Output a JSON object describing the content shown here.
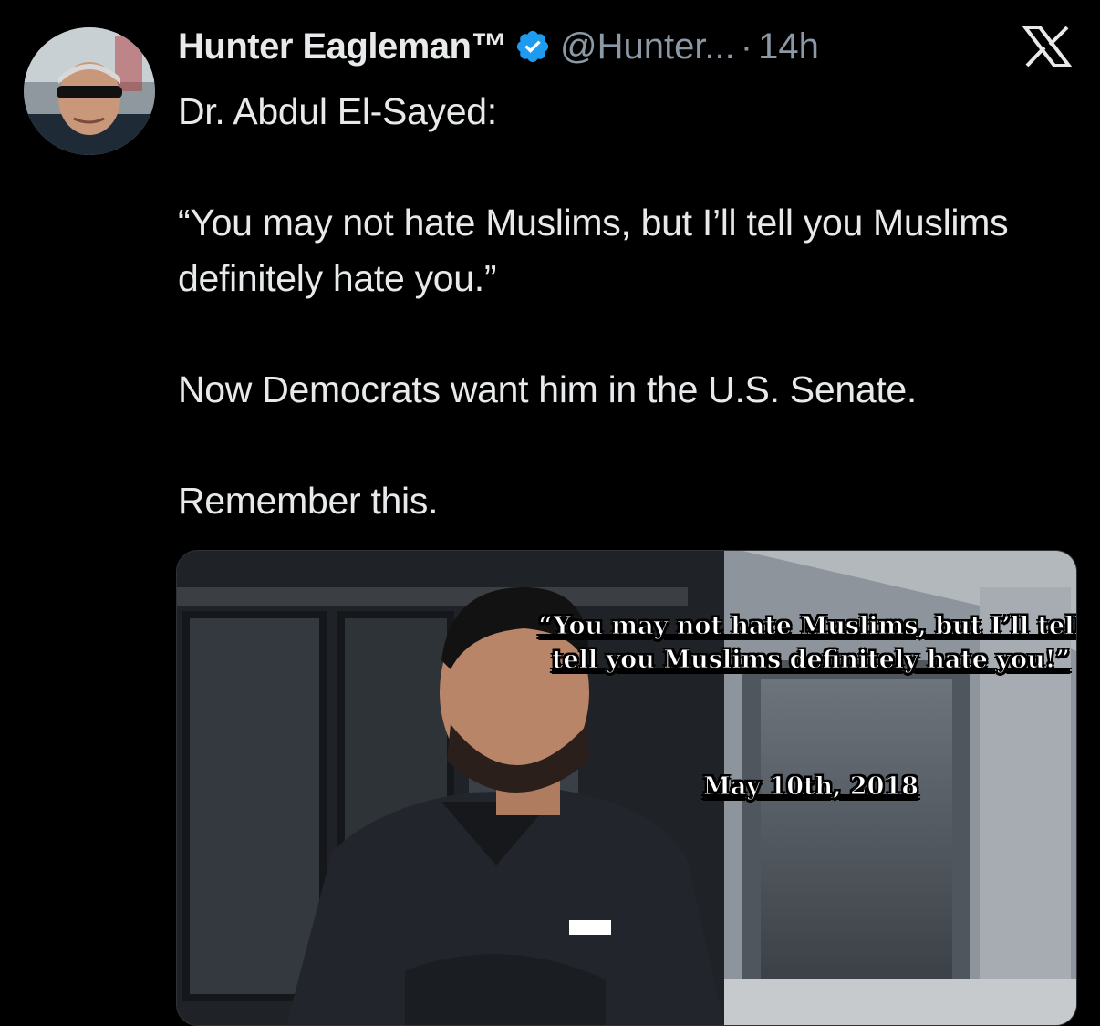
{
  "author": {
    "display_name": "Hunter Eagleman™",
    "handle": "@Hunter...",
    "separator": "·",
    "time": "14h",
    "verified": true,
    "avatar_icon": "profile-photo"
  },
  "platform_icon": "x-logo-icon",
  "tweet": {
    "lines": [
      "Dr. Abdul El-Sayed:",
      "",
      "“You may not hate Muslims, but I’ll tell you Muslims definitely hate you.”",
      "",
      "Now Democrats want him in the U.S. Senate.",
      "",
      "Remember this."
    ]
  },
  "media": {
    "overlay_quote": "“You may not hate Muslims,  but I’ll tell tell you Muslims definitely hate you!”",
    "overlay_date": "May 10th, 2018"
  },
  "colors": {
    "background": "#000000",
    "text_primary": "#e7e9ea",
    "text_secondary": "#8b98a5",
    "verified_blue": "#1d9bf0"
  }
}
